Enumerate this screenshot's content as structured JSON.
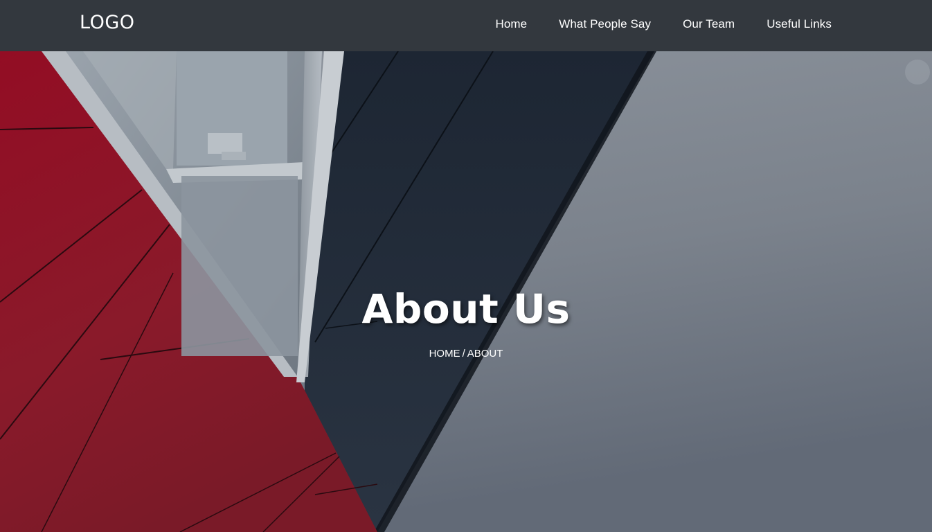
{
  "navbar": {
    "logo": "LOGO",
    "links": [
      {
        "label": "Home"
      },
      {
        "label": "What People Say"
      },
      {
        "label": "Our Team"
      },
      {
        "label": "Useful Links"
      }
    ]
  },
  "hero": {
    "title": "About Us",
    "breadcrumb": {
      "home": "HOME",
      "separator": "/",
      "current": "ABOUT"
    }
  },
  "colors": {
    "navbar_bg": "#33383e",
    "text": "#ffffff",
    "panel_red": "#8e1a2c",
    "panel_dark": "#1f2a38",
    "sky_gray": "#7d8590"
  }
}
